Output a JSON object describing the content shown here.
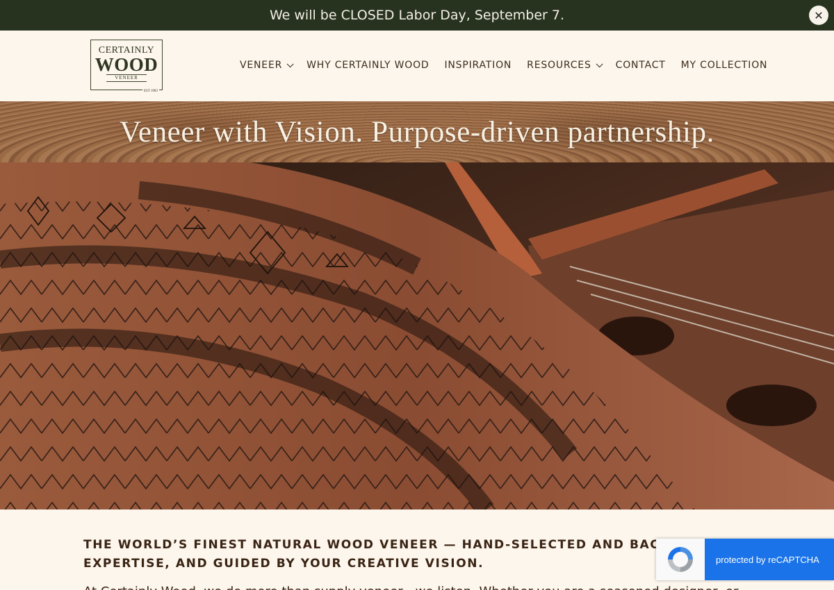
{
  "announcement": {
    "text": "We will be CLOSED Labor Day, September 7.",
    "close_label": "✕"
  },
  "logo": {
    "top": "CERTAINLY",
    "main": "WOOD",
    "sub": "VENEER",
    "est": "EST 1983"
  },
  "nav": {
    "items": [
      {
        "label": "VENEER",
        "has_dropdown": true
      },
      {
        "label": "WHY CERTAINLY WOOD",
        "has_dropdown": false
      },
      {
        "label": "INSPIRATION",
        "has_dropdown": false
      },
      {
        "label": "RESOURCES",
        "has_dropdown": true
      },
      {
        "label": "CONTACT",
        "has_dropdown": false
      },
      {
        "label": "MY COLLECTION",
        "has_dropdown": false
      }
    ]
  },
  "hero": {
    "title": "Veneer with Vision. Purpose-driven partnership."
  },
  "content": {
    "tagline_line1": "THE WORLD’S FINEST NATURAL WOOD VENEER — HAND-SELECTED AND BACKED BY",
    "tagline_line2": "EXPERTISE, AND GUIDED BY YOUR CREATIVE VISION.",
    "body": "At Certainly Wood, we do more than supply veneer—we listen. Whether you are a seasoned designer, or"
  },
  "recaptcha": {
    "label": "protected by reCAPTCHA"
  },
  "colors": {
    "announcement_bg": "#28331f",
    "page_bg": "#fdf6ec",
    "text_dark": "#3a2414",
    "recaptcha_blue": "#1a73e8"
  }
}
